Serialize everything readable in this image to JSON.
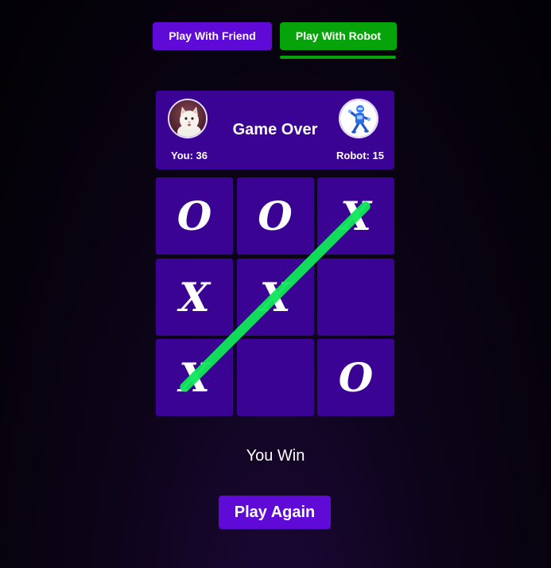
{
  "modes": {
    "friend_label": "Play With Friend",
    "robot_label": "Play With Robot",
    "active": "robot"
  },
  "scoreboard": {
    "title": "Game Over",
    "you_label": "You:",
    "you_score": "36",
    "robot_label": "Robot:",
    "robot_score": "15",
    "you_avatar_icon": "cat-avatar-icon",
    "robot_avatar_icon": "robot-avatar-icon"
  },
  "board": {
    "cells": [
      "O",
      "O",
      "X",
      "X",
      "X",
      "",
      "X",
      "",
      "O"
    ],
    "winning_cells": [
      2,
      4,
      6
    ]
  },
  "status": "You Win",
  "play_again_label": "Play Again",
  "colors": {
    "purple": "#5f0ad6",
    "panel": "#3a0394",
    "green": "#07a30a",
    "win_line": "#10e65a",
    "text": "#ffffff"
  }
}
